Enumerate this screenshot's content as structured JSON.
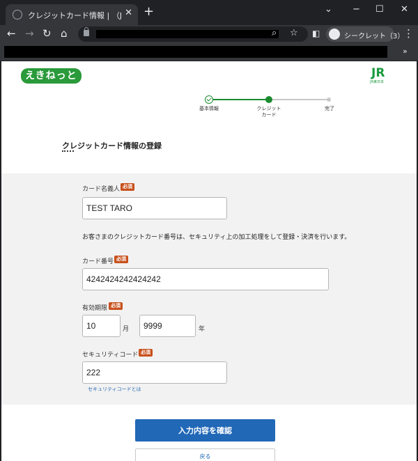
{
  "browser": {
    "tab_title": "クレジットカード情報 | （JR東日本）",
    "tab_close": "✕",
    "new_tab": "+",
    "incognito_label": "シークレット（3）",
    "bookmarks_more": "»"
  },
  "logos": {
    "left_text": "えきねっと",
    "right_text": "JR",
    "right_sub": "JR東日本"
  },
  "stepper": {
    "steps": [
      {
        "label": "基本情報",
        "state": "done"
      },
      {
        "label": "クレジット\nカード",
        "state": "current"
      },
      {
        "label": "完了",
        "state": "pending"
      }
    ],
    "active_color": "#1b8a2f",
    "pending_color": "#c8c8c8"
  },
  "page": {
    "title": "クレジットカード情報の登録"
  },
  "form": {
    "required_badge": "必須",
    "cardholder": {
      "label": "カード名義人",
      "value": "TEST TARO"
    },
    "note": "お客さまのクレジットカード番号は、セキュリティ上の加工処理をして登録・決済を行います。",
    "card_number": {
      "label": "カード番号",
      "value": "4242424242424242"
    },
    "expiry": {
      "label": "有効期限",
      "month_value": "10",
      "month_unit": "月",
      "year_value": "9999",
      "year_unit": "年"
    },
    "security_code": {
      "label": "セキュリティコード",
      "value": "222",
      "help_link": "セキュリティコードとは"
    }
  },
  "actions": {
    "confirm_label": "入力内容を確認",
    "back_label": "戻る"
  },
  "colors": {
    "primary": "#2168b7",
    "badge": "#c8501b",
    "brand_green": "#2a9a3a"
  }
}
